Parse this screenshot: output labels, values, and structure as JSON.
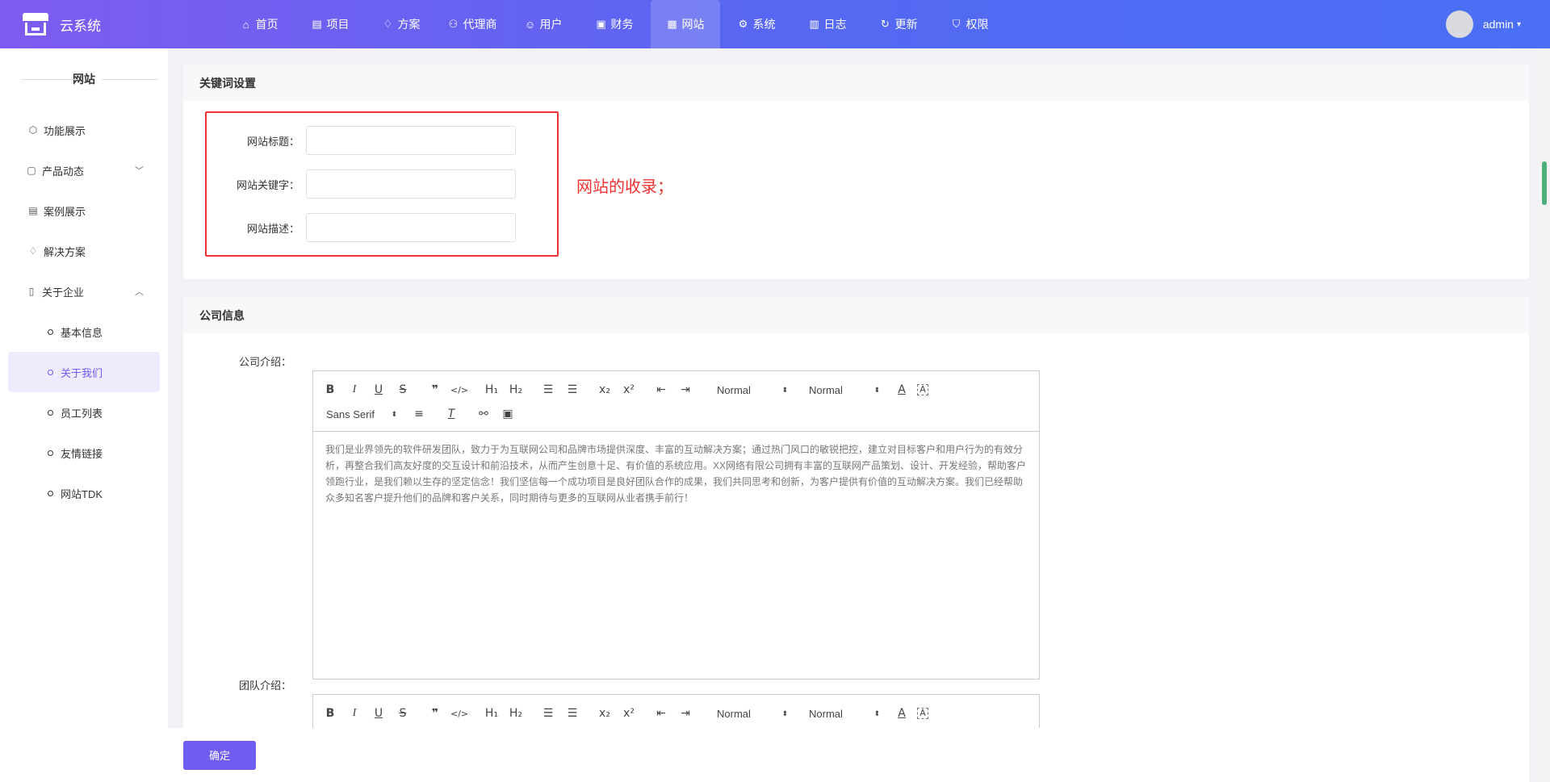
{
  "app": {
    "title": "云系统"
  },
  "nav": [
    {
      "label": "首页",
      "icon": "home-icon",
      "glyph": "⌂"
    },
    {
      "label": "项目",
      "icon": "briefcase-icon",
      "glyph": "▤"
    },
    {
      "label": "方案",
      "icon": "diamond-icon",
      "glyph": "♢"
    },
    {
      "label": "代理商",
      "icon": "agent-icon",
      "glyph": "⚇"
    },
    {
      "label": "用户",
      "icon": "user-icon",
      "glyph": "☺"
    },
    {
      "label": "财务",
      "icon": "finance-icon",
      "glyph": "▣"
    },
    {
      "label": "网站",
      "icon": "website-icon",
      "glyph": "▦",
      "active": true
    },
    {
      "label": "系统",
      "icon": "gear-icon",
      "glyph": "⚙"
    },
    {
      "label": "日志",
      "icon": "log-icon",
      "glyph": "▥"
    },
    {
      "label": "更新",
      "icon": "refresh-icon",
      "glyph": "↻"
    },
    {
      "label": "权限",
      "icon": "shield-icon",
      "glyph": "⛉"
    }
  ],
  "user": {
    "name": "admin"
  },
  "sidebar": {
    "title": "网站",
    "items": [
      {
        "label": "功能展示",
        "icon": "cube-icon",
        "glyph": "⬡"
      },
      {
        "label": "产品动态",
        "icon": "clipboard-icon",
        "glyph": "▢",
        "chevron": "﹀"
      },
      {
        "label": "案例展示",
        "icon": "case-icon",
        "glyph": "▤"
      },
      {
        "label": "解决方案",
        "icon": "diamond-icon",
        "glyph": "♢"
      },
      {
        "label": "关于企业",
        "icon": "building-icon",
        "glyph": "▯",
        "chevron": "︿"
      }
    ],
    "subitems": [
      {
        "label": "基本信息"
      },
      {
        "label": "关于我们",
        "active": true
      },
      {
        "label": "员工列表"
      },
      {
        "label": "友情链接"
      },
      {
        "label": "网站TDK"
      }
    ]
  },
  "keywords": {
    "heading": "关键词设置",
    "fields": [
      {
        "label": "网站标题：",
        "value": ""
      },
      {
        "label": "网站关键字：",
        "value": ""
      },
      {
        "label": "网站描述：",
        "value": ""
      }
    ],
    "annotation": "网站的收录；"
  },
  "company": {
    "heading": "公司信息",
    "intro_label": "公司介绍：",
    "intro_text": "我们是业界领先的软件研发团队，致力于为互联网公司和品牌市场提供深度、丰富的互动解决方案；通过热门风口的敏锐把控，建立对目标客户和用户行为的有效分析，再整合我们高友好度的交互设计和前沿技术，从而产生创意十足、有价值的系统应用。XX网络有限公司拥有丰富的互联网产品策划、设计、开发经验，帮助客户领跑行业，是我们赖以生存的坚定信念！我们坚信每一个成功项目是良好团队合作的成果，我们共同思考和创新，为客户提供有价值的互动解决方案。我们已经帮助众多知名客户提升他们的品牌和客户关系，同时期待与更多的互联网从业者携手前行！",
    "team_label": "团队介绍："
  },
  "editor_toolbar": {
    "header_select": "Normal",
    "size_select": "Normal",
    "font_select": "Sans Serif"
  },
  "footer": {
    "confirm_label": "确定"
  },
  "colors": {
    "accent": "#6f5cf0",
    "annotation": "#e33333",
    "topbar_start": "#7e5bf0",
    "topbar_end": "#4a6ff5"
  }
}
